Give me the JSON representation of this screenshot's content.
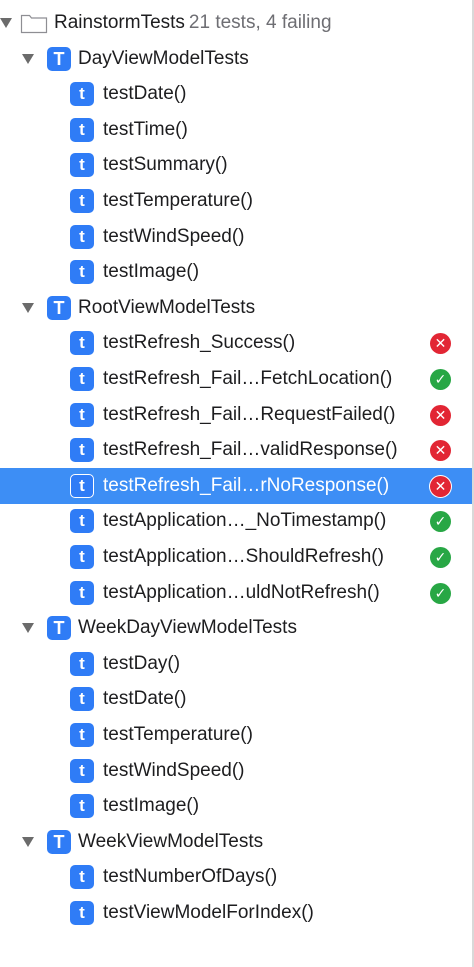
{
  "root": {
    "name": "RainstormTests",
    "summary": "21 tests, 4 failing"
  },
  "suites": [
    {
      "name": "DayViewModelTests",
      "tests": [
        {
          "name": "testDate()",
          "status": ""
        },
        {
          "name": "testTime()",
          "status": ""
        },
        {
          "name": "testSummary()",
          "status": ""
        },
        {
          "name": "testTemperature()",
          "status": ""
        },
        {
          "name": "testWindSpeed()",
          "status": ""
        },
        {
          "name": "testImage()",
          "status": ""
        }
      ]
    },
    {
      "name": "RootViewModelTests",
      "tests": [
        {
          "name": "testRefresh_Success()",
          "status": "fail"
        },
        {
          "name": "testRefresh_Fail…FetchLocation()",
          "status": "pass"
        },
        {
          "name": "testRefresh_Fail…RequestFailed()",
          "status": "fail"
        },
        {
          "name": "testRefresh_Fail…validResponse()",
          "status": "fail"
        },
        {
          "name": "testRefresh_Fail…rNoResponse()",
          "status": "fail",
          "selected": true
        },
        {
          "name": "testApplication…_NoTimestamp()",
          "status": "pass"
        },
        {
          "name": "testApplication…ShouldRefresh()",
          "status": "pass"
        },
        {
          "name": "testApplication…uldNotRefresh()",
          "status": "pass"
        }
      ]
    },
    {
      "name": "WeekDayViewModelTests",
      "tests": [
        {
          "name": "testDay()",
          "status": ""
        },
        {
          "name": "testDate()",
          "status": ""
        },
        {
          "name": "testTemperature()",
          "status": ""
        },
        {
          "name": "testWindSpeed()",
          "status": ""
        },
        {
          "name": "testImage()",
          "status": ""
        }
      ]
    },
    {
      "name": "WeekViewModelTests",
      "tests": [
        {
          "name": "testNumberOfDays()",
          "status": ""
        },
        {
          "name": "testViewModelForIndex()",
          "status": ""
        }
      ]
    }
  ],
  "icons": {
    "suite_badge": "T",
    "test_badge": "t",
    "fail": "✕",
    "pass": "✓"
  },
  "colors": {
    "badge_blue": "#2f7cf6",
    "selection": "#3d8ef5",
    "fail": "#e22634",
    "pass": "#28a745"
  }
}
